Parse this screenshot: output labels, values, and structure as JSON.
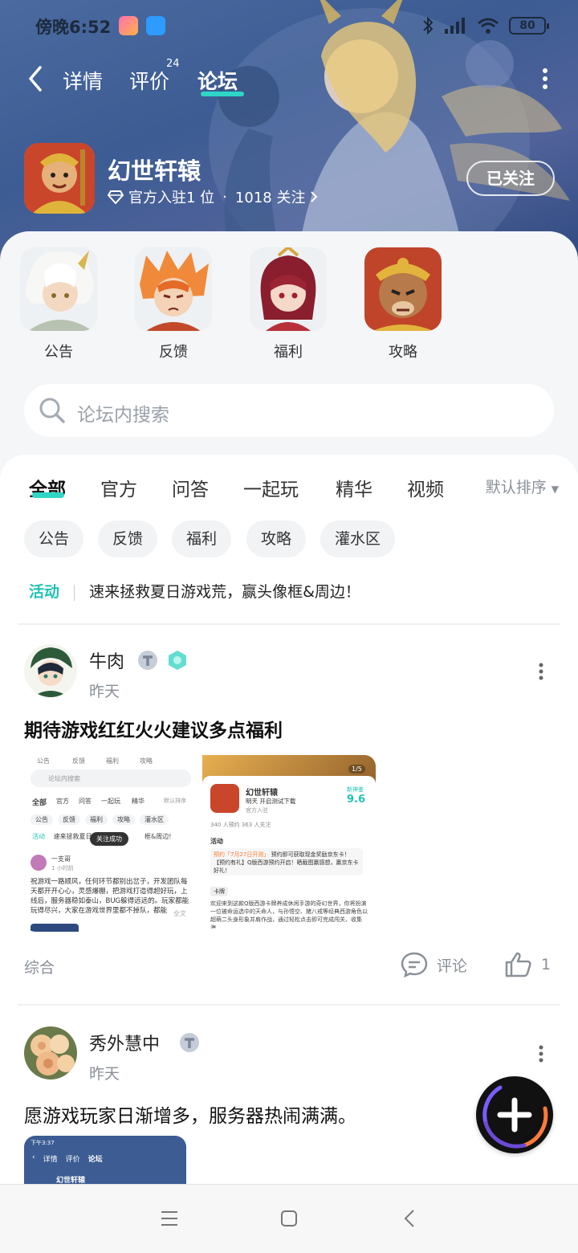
{
  "status_bar": {
    "time": "傍晚6:52",
    "battery": "80"
  },
  "nav": {
    "tabs": [
      "详情",
      "评价",
      "论坛"
    ],
    "review_count": "24",
    "active_tab": "论坛"
  },
  "game": {
    "title": "幻世轩辕",
    "official": "官方入驻1 位",
    "dot": "·",
    "followers": "1018 关注",
    "follow_label": "已关注"
  },
  "categories": [
    "公告",
    "反馈",
    "福利",
    "攻略"
  ],
  "search": {
    "placeholder": "论坛内搜索"
  },
  "feed_tabs": [
    "全部",
    "官方",
    "问答",
    "一起玩",
    "精华",
    "视频"
  ],
  "sort": "默认排序",
  "chips": [
    "公告",
    "反馈",
    "福利",
    "攻略",
    "灌水区"
  ],
  "activity": {
    "tag": "活动",
    "text": "速来拯救夏日游戏荒，赢头像框&周边！"
  },
  "posts": [
    {
      "user": "牛肉",
      "time": "昨天",
      "title": "期待游戏红红火火建议多点福利",
      "tag": "综合",
      "comment_label": "评论",
      "likes": "1"
    },
    {
      "user": "秀外慧中",
      "time": "昨天",
      "title": "愿游戏玩家日渐增多，服务器热闹满满。"
    }
  ],
  "thumb1": {
    "cats": [
      "公告",
      "反馈",
      "福利",
      "攻略"
    ],
    "search": "论坛内搜索",
    "tabs": [
      "全部",
      "官方",
      "问答",
      "一起玩",
      "精华",
      "默认排序"
    ],
    "chips": [
      "公告",
      "反馈",
      "福利",
      "攻略",
      "灌水区"
    ],
    "act_tag": "活动",
    "act_text": "速来拯救夏日",
    "act_text2": "框&周边!",
    "toast": "关注成功",
    "user": "一支哥",
    "time": "1 小时前",
    "body": "祝游戏一路顺风，任何环节都别出岔子，开发团队每天都开开心心，灵感爆棚，把游戏打造得超好玩，上线后，服务器稳如泰山，BUG躲得远远的。玩家都能玩得尽兴，大家在游戏世界里都不掉队，都能",
    "more": "全文"
  },
  "thumb2": {
    "page": "1/5",
    "title": "幻世轩辕",
    "sub": "明天 开启测试下载",
    "official": "官方入驻",
    "score_label": "新神鉴",
    "score": "9.6",
    "stats": "340 人预约  363 人关注",
    "act": "活动",
    "act_tag": "预约「7月27日开测」",
    "act_text": "预约即可获取现金奖励京东卡！【预约有礼】Q版西游预约开启！晒截图赢感想，赢京东卡好礼！",
    "label": "卡牌",
    "desc": "欢迎来到这款Q版西游卡牌养成休闲手游的奇幻世界，你将扮演一位被命运选中的天命人，与孙悟空、猪八戒等经典西游角色以超萌二头身形象并肩作战，通过轻松点击即可完成闯关、收集海..."
  },
  "thumb3": {
    "time": "下午3:37",
    "tabs": [
      "详情",
      "评价",
      "论坛"
    ],
    "title": "幻世轩辕"
  },
  "colors": {
    "accent": "#2fd6c5",
    "activity": "#21c3b3",
    "hero": "#3c5c93"
  },
  "icons": [
    "back-icon",
    "more-icon",
    "diamond-icon",
    "search-icon",
    "comment-icon",
    "thumb-up-icon",
    "plus-icon",
    "menu-icon",
    "home-icon",
    "nav-back-icon",
    "bluetooth-icon",
    "signal-icon",
    "wifi-icon"
  ]
}
